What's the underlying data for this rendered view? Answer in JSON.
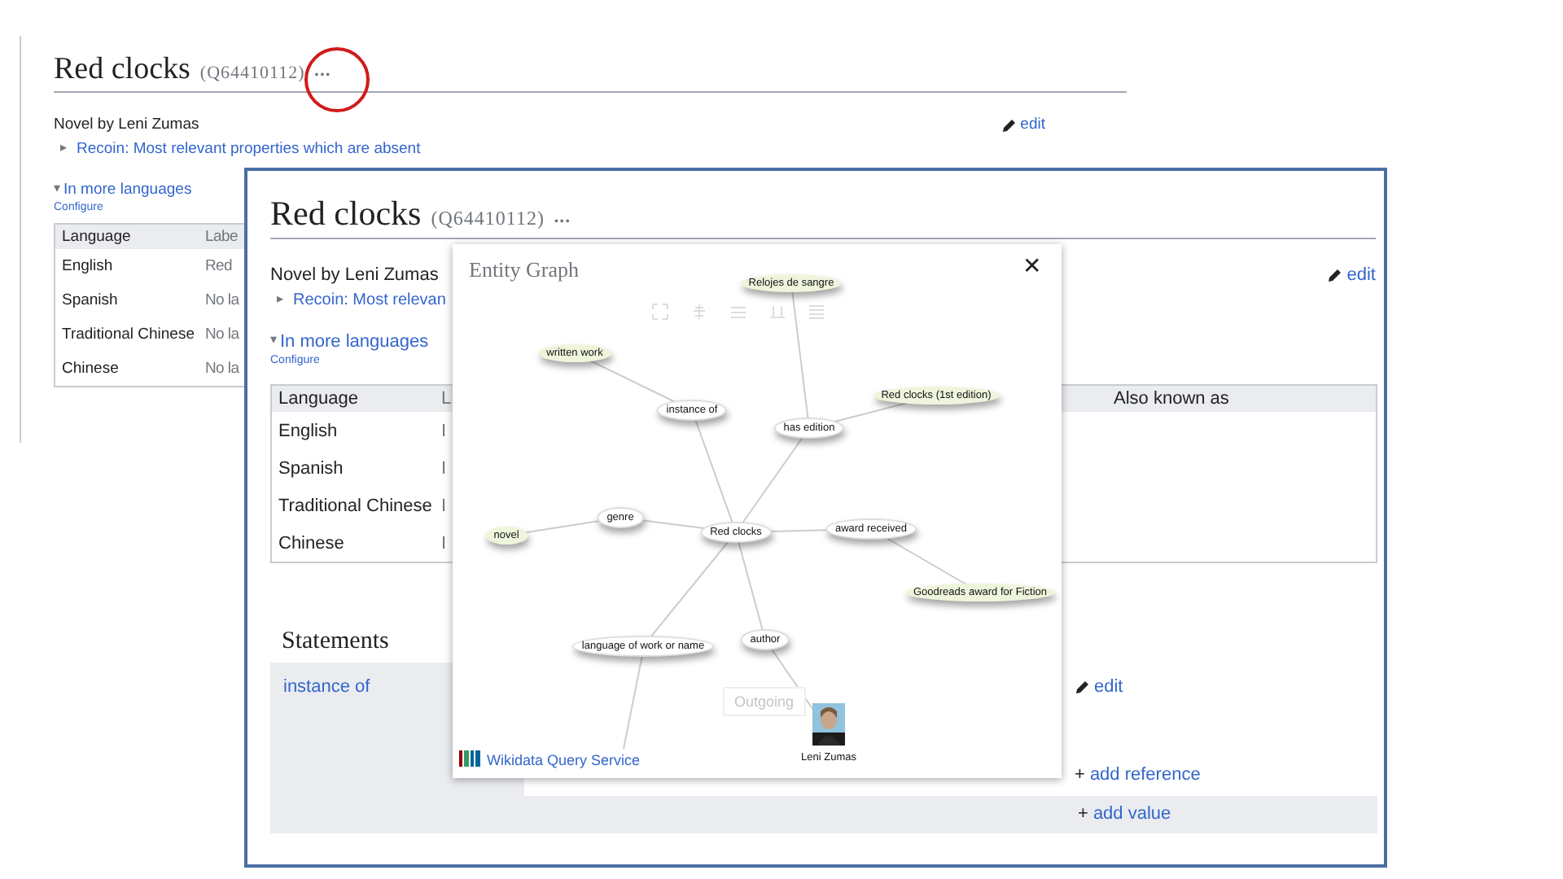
{
  "back_page": {
    "title": "Red clocks",
    "entity_id": "(Q64410112)",
    "more": "•••",
    "description": "Novel by Leni Zumas",
    "edit": "edit",
    "recoin_toggle": "▸",
    "recoin": "Recoin: Most relevant properties which are absent",
    "languages_toggle": "▾",
    "languages": "In more languages",
    "configure": "Configure",
    "table": {
      "columns": [
        "Language",
        "Labe"
      ],
      "rows": [
        [
          "English",
          "Red"
        ],
        [
          "Spanish",
          "No la"
        ],
        [
          "Traditional Chinese",
          "No la"
        ],
        [
          "Chinese",
          "No la"
        ]
      ]
    }
  },
  "front_page": {
    "title": "Red clocks",
    "entity_id": "(Q64410112)",
    "more": "•••",
    "description": "Novel by Leni Zumas",
    "edit": "edit",
    "recoin_toggle": "▸",
    "recoin": "Recoin: Most relevan",
    "languages_toggle": "▾",
    "languages": "In more languages",
    "configure": "Configure",
    "table": {
      "columns": [
        "Language",
        "L",
        "Also known as"
      ],
      "rows": [
        [
          "English",
          "I",
          ""
        ],
        [
          "Spanish",
          "I",
          ""
        ],
        [
          "Traditional Chinese",
          "I",
          ""
        ],
        [
          "Chinese",
          "I",
          ""
        ]
      ]
    },
    "statements": {
      "heading": "Statements",
      "property": "instance of",
      "edit": "edit",
      "add_reference_sign": "+",
      "add_reference": "add reference",
      "add_value_sign": "+",
      "add_value": "add value"
    }
  },
  "entity_graph": {
    "title": "Entity Graph",
    "close": "✕",
    "outgoing": "Outgoing",
    "footer": "Wikidata Query Service",
    "nodes": [
      {
        "label": "Relojes de sangre",
        "kind": "item"
      },
      {
        "label": "written work",
        "kind": "item"
      },
      {
        "label": "instance of",
        "kind": "property"
      },
      {
        "label": "has edition",
        "kind": "property"
      },
      {
        "label": "Red clocks (1st edition)",
        "kind": "item"
      },
      {
        "label": "genre",
        "kind": "property"
      },
      {
        "label": "novel",
        "kind": "item"
      },
      {
        "label": "Red clocks",
        "kind": "property"
      },
      {
        "label": "award received",
        "kind": "property"
      },
      {
        "label": "Goodreads award for Fiction",
        "kind": "item"
      },
      {
        "label": "language of work or name",
        "kind": "property"
      },
      {
        "label": "author",
        "kind": "property"
      },
      {
        "label": "Leni Zumas",
        "kind": "person"
      }
    ]
  }
}
